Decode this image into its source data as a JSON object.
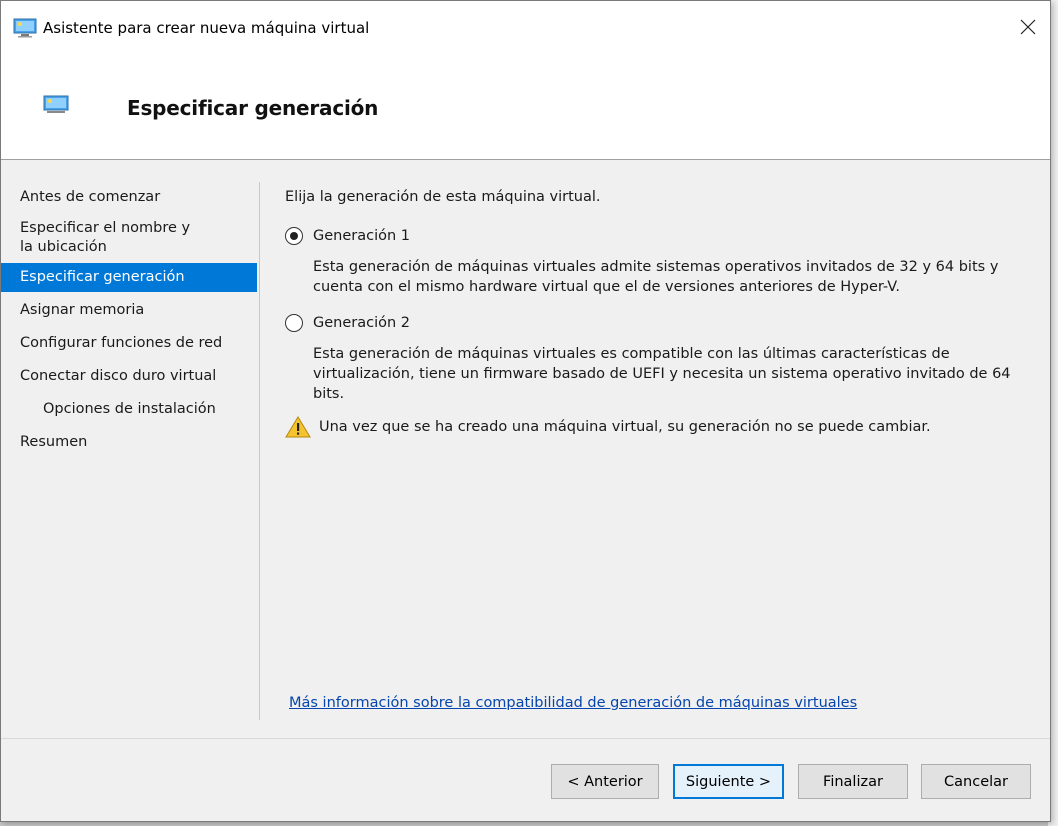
{
  "window": {
    "title": "Asistente para crear nueva máquina virtual"
  },
  "header": {
    "title": "Especificar generación"
  },
  "nav": {
    "items": [
      {
        "label": "Antes de comenzar"
      },
      {
        "label": "Especificar el nombre y la ubicación"
      },
      {
        "label": "Especificar generación",
        "active": true
      },
      {
        "label": "Asignar memoria"
      },
      {
        "label": "Configurar funciones de red"
      },
      {
        "label": "Conectar disco duro virtual"
      },
      {
        "label": "Opciones de instalación",
        "sub": true
      },
      {
        "label": "Resumen"
      }
    ]
  },
  "content": {
    "intro": "Elija la generación de esta máquina virtual.",
    "gen1": {
      "label": "Generación 1",
      "selected": true,
      "description": "Esta generación de máquinas virtuales admite sistemas operativos invitados de 32 y 64 bits y cuenta con el mismo hardware virtual que el de versiones anteriores de Hyper-V."
    },
    "gen2": {
      "label": "Generación 2",
      "selected": false,
      "description": "Esta generación de máquinas virtuales es compatible con las últimas características de virtualización, tiene un firmware basado de UEFI y necesita un sistema operativo invitado de 64 bits."
    },
    "warning": "Una vez que se ha creado una máquina virtual, su generación no se puede cambiar.",
    "link": "Más información sobre la compatibilidad de generación de máquinas virtuales"
  },
  "buttons": {
    "previous": "< Anterior",
    "next": "Siguiente >",
    "finish": "Finalizar",
    "cancel": "Cancelar"
  },
  "icons": {
    "title": "virtual-machine-icon",
    "header": "virtual-machine-icon",
    "close": "close-icon",
    "warning": "warning-icon"
  },
  "colors": {
    "accent": "#0078d7",
    "link": "#0645ad",
    "warning": "#f4c430"
  }
}
